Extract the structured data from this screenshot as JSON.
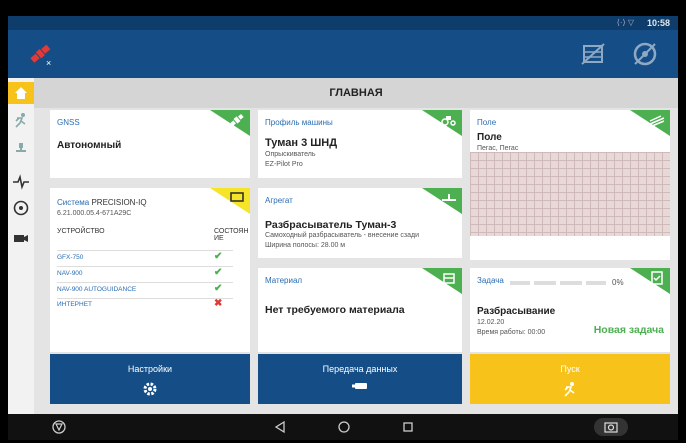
{
  "status_bar": {
    "clock": "10:58",
    "signal": "⟨·⟩ ▽"
  },
  "main_title": "ГЛАВНАЯ",
  "gnss": {
    "title": "GNSS",
    "status": "Автономный"
  },
  "system": {
    "title": "Система",
    "model": "PRECISION-IQ",
    "version": "6.21.000.05.4-671A29C",
    "col_device": "УСТРОЙСТВО",
    "col_state_1": "СОСТОЯН",
    "col_state_2": "ИЕ",
    "devices": [
      {
        "name": "GFX-750",
        "state": "✔",
        "color": "#4caf50"
      },
      {
        "name": "NAV-900",
        "state": "✔",
        "color": "#4caf50"
      },
      {
        "name": "NAV-900 AUTOGUIDANCE",
        "state": "✔",
        "color": "#4caf50"
      },
      {
        "name": "ИНТЕРНЕТ",
        "state": "✖",
        "color": "#e53935"
      }
    ]
  },
  "machine": {
    "title": "Профиль машины",
    "name": "Туман 3 ШНД",
    "line1": "Опрыскиватель",
    "line2": "EZ-Pilot Pro"
  },
  "implement": {
    "title": "Агрегат",
    "name": "Разбрасыватель Туман-3",
    "line1": "Самоходный разбрасыватель - внесение сзади",
    "line2": "Ширина полосы: 28.00 м"
  },
  "material": {
    "title": "Материал",
    "name": "Нет требуемого материала"
  },
  "field": {
    "title": "Поле",
    "name": "Поле",
    "sub": "Пегас, Пегас"
  },
  "task": {
    "title": "Задача",
    "progress_label": "0%",
    "progress": 0,
    "name": "Разбрасывание",
    "date": "12.02.20",
    "work_time": "Время работы: 00:00",
    "new_task": "Новая задача"
  },
  "buttons": {
    "settings": "Настройки",
    "transfer": "Передача данных",
    "start": "Пуск"
  },
  "colors": {
    "appbar": "#154e86",
    "accent": "#f7c21a",
    "tile_green": "#4caf50",
    "tile_yellow": "#f5e428",
    "link": "#2a6db3",
    "new_task": "#4caf50"
  }
}
